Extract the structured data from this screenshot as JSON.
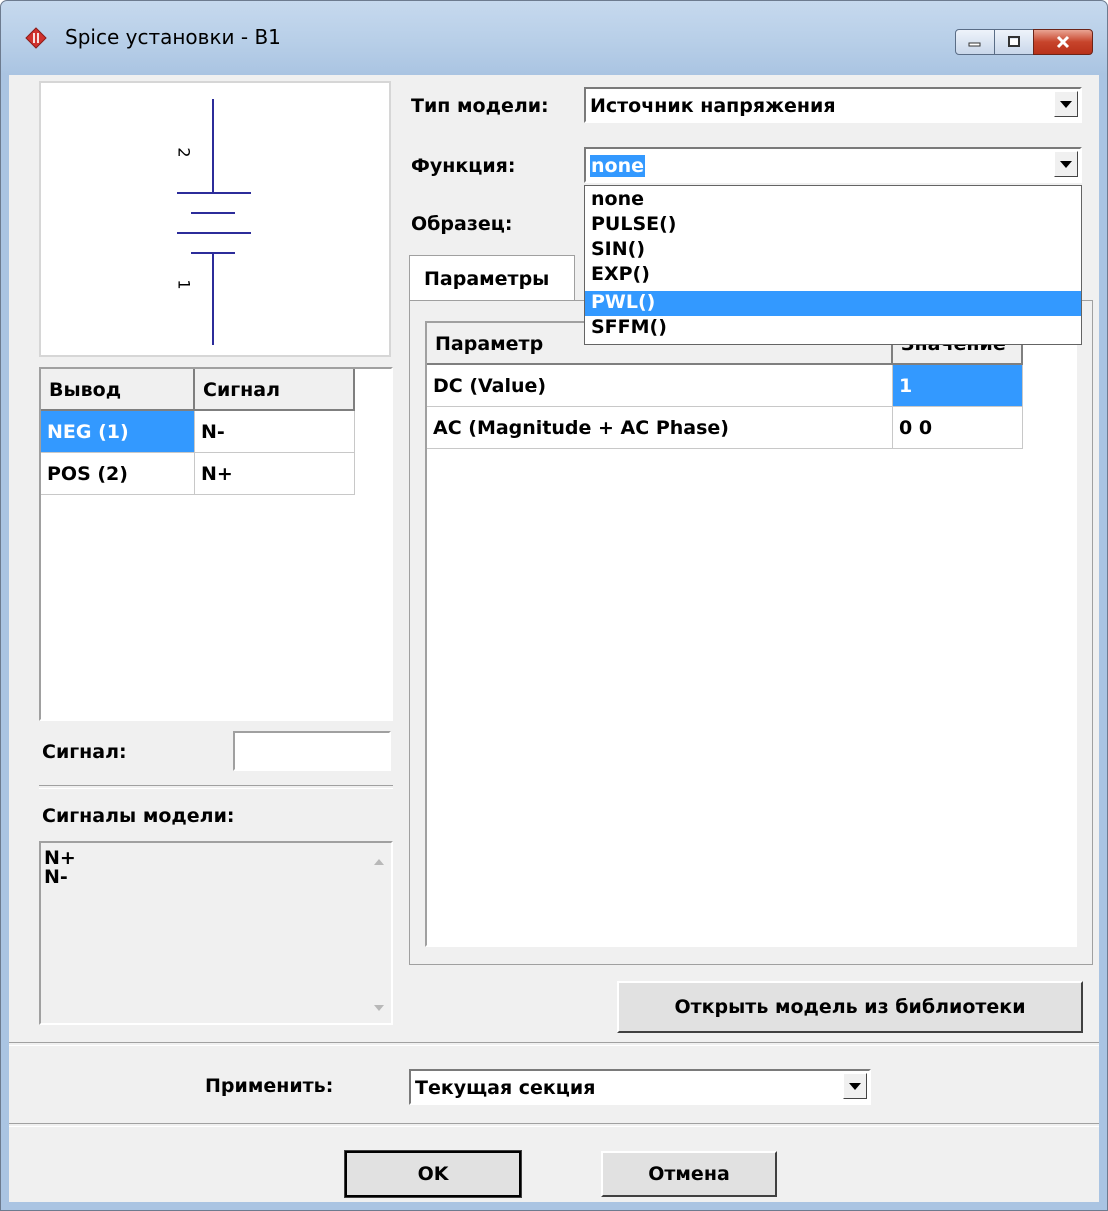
{
  "window": {
    "title": "Spice установки - B1"
  },
  "schematic": {
    "pin_top": "2",
    "pin_bottom": "1"
  },
  "pins_table": {
    "headers": [
      "Вывод",
      "Сигнал"
    ],
    "rows": [
      {
        "pin": "NEG (1)",
        "signal": "N-",
        "selected": true
      },
      {
        "pin": "POS (2)",
        "signal": "N+",
        "selected": false
      }
    ]
  },
  "signal_field": {
    "label": "Сигнал:",
    "value": ""
  },
  "model_signals": {
    "label": "Сигналы модели:",
    "items": [
      "N+",
      "N-"
    ]
  },
  "model_type": {
    "label": "Тип модели:",
    "value": "Источник напряжения"
  },
  "function": {
    "label": "Функция:",
    "value": "none",
    "options": [
      "none",
      "PULSE()",
      "SIN()",
      "EXP()",
      "PWL()",
      "SFFM()"
    ],
    "highlighted": "PWL()"
  },
  "sample": {
    "label": "Образец:"
  },
  "tabs": {
    "active": "Параметры"
  },
  "params_table": {
    "headers": [
      "Параметр",
      "Значение"
    ],
    "rows": [
      {
        "name": "DC (Value)",
        "value": "1"
      },
      {
        "name": "AC (Magnitude + AC Phase)",
        "value": "0 0"
      }
    ]
  },
  "open_library_button": "Открыть модель из библиотеки",
  "apply": {
    "label": "Применить:",
    "value": "Текущая секция"
  },
  "ok_button": "OK",
  "cancel_button": "Отмена",
  "colors": {
    "selection": "#3399ff",
    "schematic_stroke": "#2c2c9a",
    "face": "#f0f0f0"
  }
}
